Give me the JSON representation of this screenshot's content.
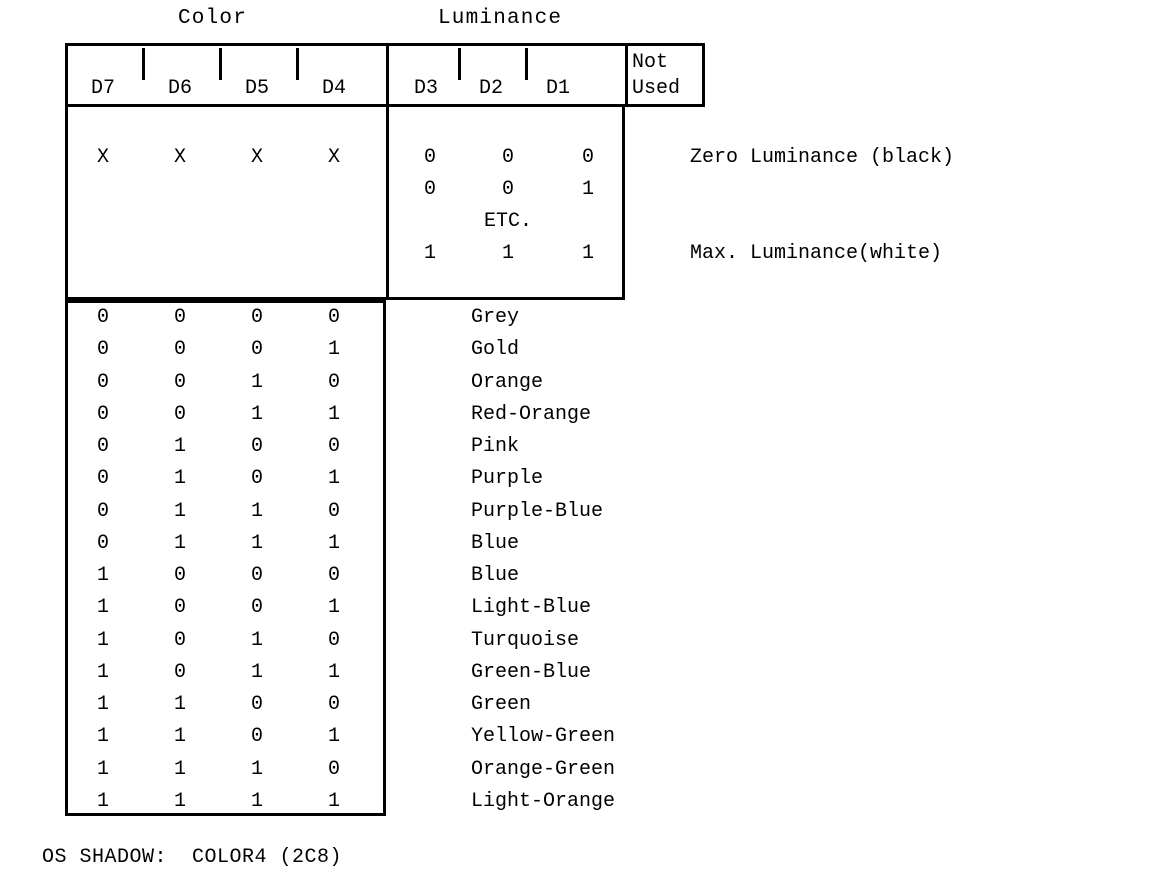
{
  "document": {
    "group_headers": {
      "color": "Color",
      "luminance": "Luminance"
    },
    "bit_headers": {
      "d7": "D7",
      "d6": "D6",
      "d5": "D5",
      "d4": "D4",
      "d3": "D3",
      "d2": "D2",
      "d1": "D1",
      "not_used_line1": "Not",
      "not_used_line2": "Used"
    },
    "luminance_block": {
      "dont_care": {
        "d7": "X",
        "d6": "X",
        "d5": "X",
        "d4": "X"
      },
      "rows": [
        {
          "d3": "0",
          "d2": "0",
          "d1": "0",
          "note": "Zero Luminance (black)"
        },
        {
          "d3": "0",
          "d2": "0",
          "d1": "1",
          "note": ""
        },
        {
          "d3": "1",
          "d2": "1",
          "d1": "1",
          "note": "Max.  Luminance(white)"
        }
      ],
      "etc": "ETC."
    },
    "color_table": {
      "columns": [
        "D7",
        "D6",
        "D5",
        "D4",
        "Color"
      ],
      "rows": [
        {
          "d7": "0",
          "d6": "0",
          "d5": "0",
          "d4": "0",
          "name": "Grey"
        },
        {
          "d7": "0",
          "d6": "0",
          "d5": "0",
          "d4": "1",
          "name": "Gold"
        },
        {
          "d7": "0",
          "d6": "0",
          "d5": "1",
          "d4": "0",
          "name": "Orange"
        },
        {
          "d7": "0",
          "d6": "0",
          "d5": "1",
          "d4": "1",
          "name": "Red-Orange"
        },
        {
          "d7": "0",
          "d6": "1",
          "d5": "0",
          "d4": "0",
          "name": "Pink"
        },
        {
          "d7": "0",
          "d6": "1",
          "d5": "0",
          "d4": "1",
          "name": "Purple"
        },
        {
          "d7": "0",
          "d6": "1",
          "d5": "1",
          "d4": "0",
          "name": "Purple-Blue"
        },
        {
          "d7": "0",
          "d6": "1",
          "d5": "1",
          "d4": "1",
          "name": "Blue"
        },
        {
          "d7": "1",
          "d6": "0",
          "d5": "0",
          "d4": "0",
          "name": "Blue"
        },
        {
          "d7": "1",
          "d6": "0",
          "d5": "0",
          "d4": "1",
          "name": "Light-Blue"
        },
        {
          "d7": "1",
          "d6": "0",
          "d5": "1",
          "d4": "0",
          "name": "Turquoise"
        },
        {
          "d7": "1",
          "d6": "0",
          "d5": "1",
          "d4": "1",
          "name": "Green-Blue"
        },
        {
          "d7": "1",
          "d6": "1",
          "d5": "0",
          "d4": "0",
          "name": "Green"
        },
        {
          "d7": "1",
          "d6": "1",
          "d5": "0",
          "d4": "1",
          "name": "Yellow-Green"
        },
        {
          "d7": "1",
          "d6": "1",
          "d5": "1",
          "d4": "0",
          "name": "Orange-Green"
        },
        {
          "d7": "1",
          "d6": "1",
          "d5": "1",
          "d4": "1",
          "name": "Light-Orange"
        }
      ]
    },
    "footer": "OS SHADOW:  COLOR4 (2C8)"
  }
}
